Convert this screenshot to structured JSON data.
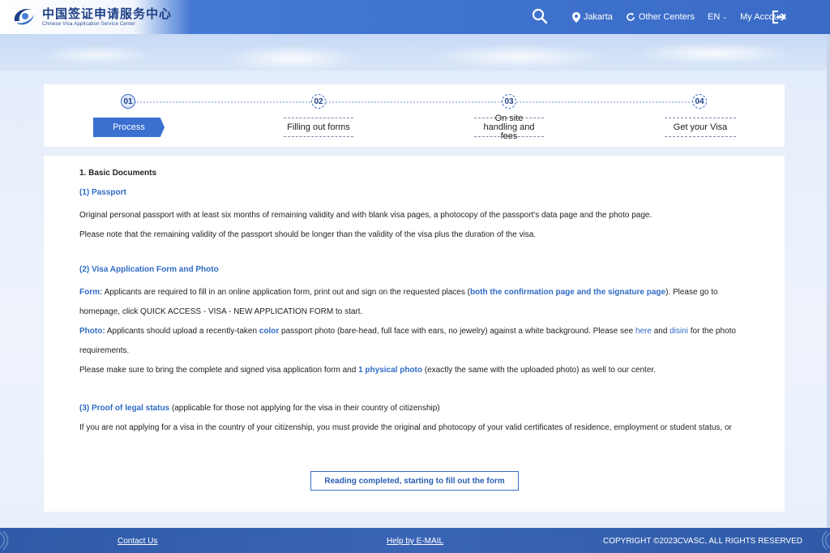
{
  "header": {
    "brand_cn": "中国签证申请服务中心",
    "brand_en": "Chinese Visa Application Service Center",
    "location": "Jakarta",
    "other_centers": "Other Centers",
    "language": "EN",
    "my_account": "My Account"
  },
  "steps": [
    {
      "num": "01",
      "label": "Process"
    },
    {
      "num": "02",
      "label": "Filling out forms"
    },
    {
      "num": "03",
      "label": "On site handling and fees"
    },
    {
      "num": "04",
      "label": "Get your Visa"
    }
  ],
  "content": {
    "section1": "1. Basic Documents",
    "passport_title": "(1) Passport",
    "passport_p1": "Original personal passport with at least six months of remaining validity and with blank visa pages, a photocopy of the passport's data page and the photo page.",
    "passport_p2": "Please note that the remaining validity of the passport should be longer than the validity of the visa plus the duration of the visa.",
    "form_title": "(2) Visa Application Form and Photo",
    "form_label": "Form:",
    "form_text_a": " Applicants are required to fill in an online application form, print out and sign on the requested places (",
    "form_highlight": "both the confirmation page and the signature page",
    "form_text_b": "). Please go to homepage, click QUICK ACCESS - VISA - NEW APPLICATION FORM to start.",
    "photo_label": "Photo:",
    "photo_text_a": " Applicants should upload a recently-taken ",
    "photo_color": "color",
    "photo_text_b": " passport photo (bare-head, full face with ears, no jewelry) against a white background. Please see ",
    "photo_here": "here",
    "photo_and": " and ",
    "photo_disini": "disini",
    "photo_text_c": " for the photo requirements.",
    "bring_text_a": "Please make sure to bring the complete and signed visa application form and ",
    "bring_highlight": "1 physical photo",
    "bring_text_b": " (exactly the same with the uploaded photo) as well to our center.",
    "legal_title": "(3) Proof of legal status",
    "legal_note": " (applicable for those not applying for the visa in their country of citizenship)",
    "legal_p": "If you are not applying for a visa in the country of your citizenship, you must provide the original and photocopy of your valid certificates of residence, employment or student status, or actual situation."
  },
  "cta_label": "Reading completed, starting to fill out the form",
  "footer": {
    "contact": "Contact Us",
    "help": "Help by E-MAIL",
    "copyright": "COPYRIGHT ©2023CVASC, ALL RIGHTS RESERVED"
  }
}
